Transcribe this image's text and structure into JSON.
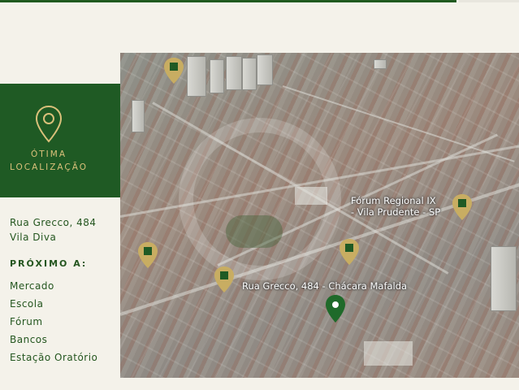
{
  "sidebar": {
    "location_title": "ÓTIMA\nLOCALIZAÇÃO",
    "address": "Rua Grecco, 484\nVila Diva",
    "nearby_title": "PRÓXIMO A:",
    "nearby_items": [
      "Mercado",
      "Escola",
      "Fórum",
      "Bancos",
      "Estação Oratório"
    ]
  },
  "map": {
    "label_forum": "Fórum Regional IX\n- Vila Prudente - SP",
    "label_address": "Rua Grecco, 484 - Chácara Mafalda"
  },
  "icons": {
    "location_pin": "map-pin-outline-icon",
    "poi_pin": "gold-map-pin-icon",
    "home_pin": "green-map-pin-icon"
  },
  "colors": {
    "panel_green": "#1f5a24",
    "gold": "#d9c07a",
    "text_green": "#24561f",
    "background": "#f4f2ea"
  }
}
